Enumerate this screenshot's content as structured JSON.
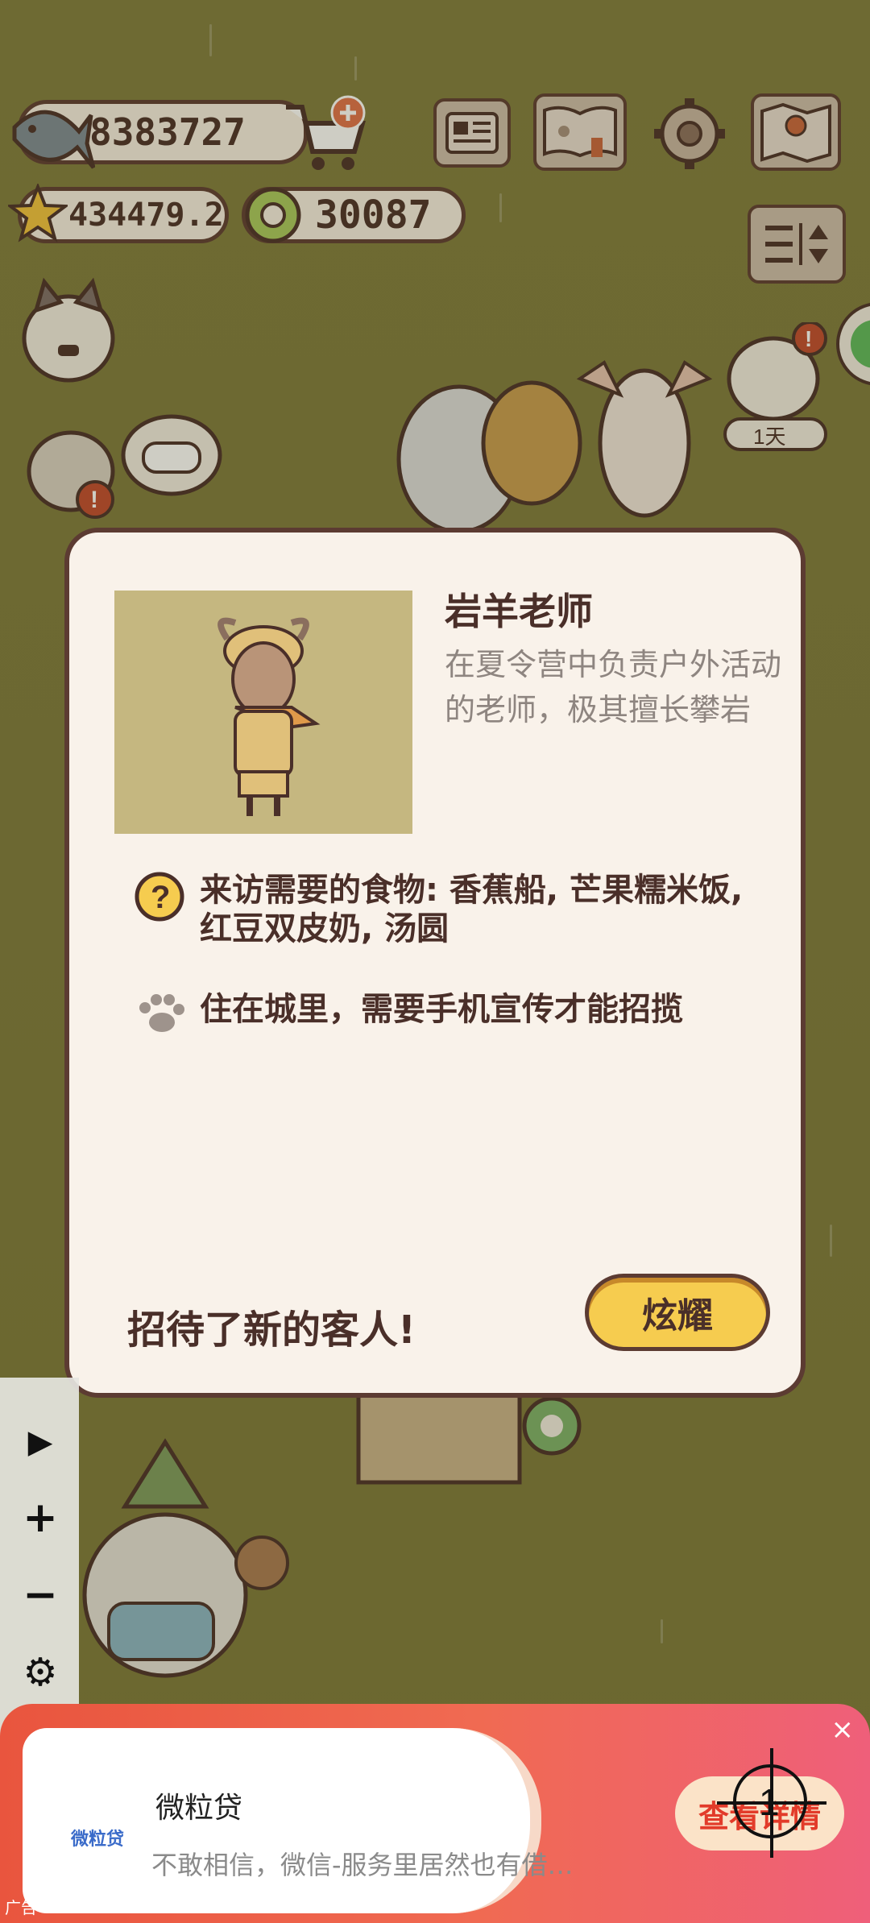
{
  "hud": {
    "fish": "8383727",
    "stars": "434479.2",
    "coins": "30087",
    "cart_icon": "cart-plus-icon",
    "menu_icons": [
      "newspaper-icon",
      "pawbook-icon",
      "gear-icon",
      "map-icon"
    ],
    "sort_icon": "sort-icon"
  },
  "scene": {
    "day_badge": "1天"
  },
  "modal": {
    "name": "岩羊老师",
    "description": "在夏令营中负责户外活动的老师，极其擅长攀岩",
    "food_text": "来访需要的食物: 香蕉船, 芒果糯米饭, 红豆双皮奶, 汤圆",
    "hint_text": "住在城里，需要手机宣传才能招揽",
    "footer_text": "招待了新的客人!",
    "boast_button": "炫耀"
  },
  "toolbar": {
    "items": [
      {
        "icon": "play-icon",
        "glyph": "▶"
      },
      {
        "icon": "plus-icon",
        "glyph": "+"
      },
      {
        "icon": "minus-icon",
        "glyph": "−"
      },
      {
        "icon": "settings-icon",
        "glyph": "⚙"
      },
      {
        "icon": "hide-icon",
        "glyph": "⊘"
      },
      {
        "icon": "move-icon",
        "glyph": "✥"
      },
      {
        "icon": "close-icon",
        "glyph": "✕"
      }
    ]
  },
  "ad": {
    "brand": "微粒贷",
    "title": "微粒贷",
    "subtitle": "不敢相信，微信-服务里居然也有借…",
    "button": "查看详情",
    "close": "×",
    "label": "广告",
    "target_number": "1"
  },
  "colors": {
    "background": "#7e7a3c",
    "modal_bg": "#f9f2ea",
    "border": "#5c3b32",
    "button": "#f6cc4f"
  }
}
